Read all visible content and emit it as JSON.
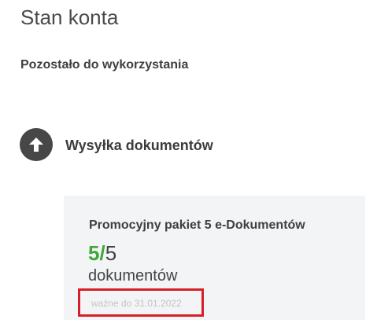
{
  "page": {
    "title": "Stan konta",
    "subtitle": "Pozostało do wykorzystania"
  },
  "section": {
    "icon": "arrow-up-icon",
    "title": "Wysyłka dokumentów"
  },
  "package": {
    "name": "Promocyjny pakiet 5 e-Dokumentów",
    "remaining": "5",
    "separator": "/",
    "total": "5",
    "unit": "dokumentów",
    "validity": "ważne do 31.01.2022"
  },
  "colors": {
    "accent_green": "#3ea83a",
    "highlight_red": "#d71f27",
    "card_background": "#f3f4f5",
    "icon_background": "#474747"
  }
}
